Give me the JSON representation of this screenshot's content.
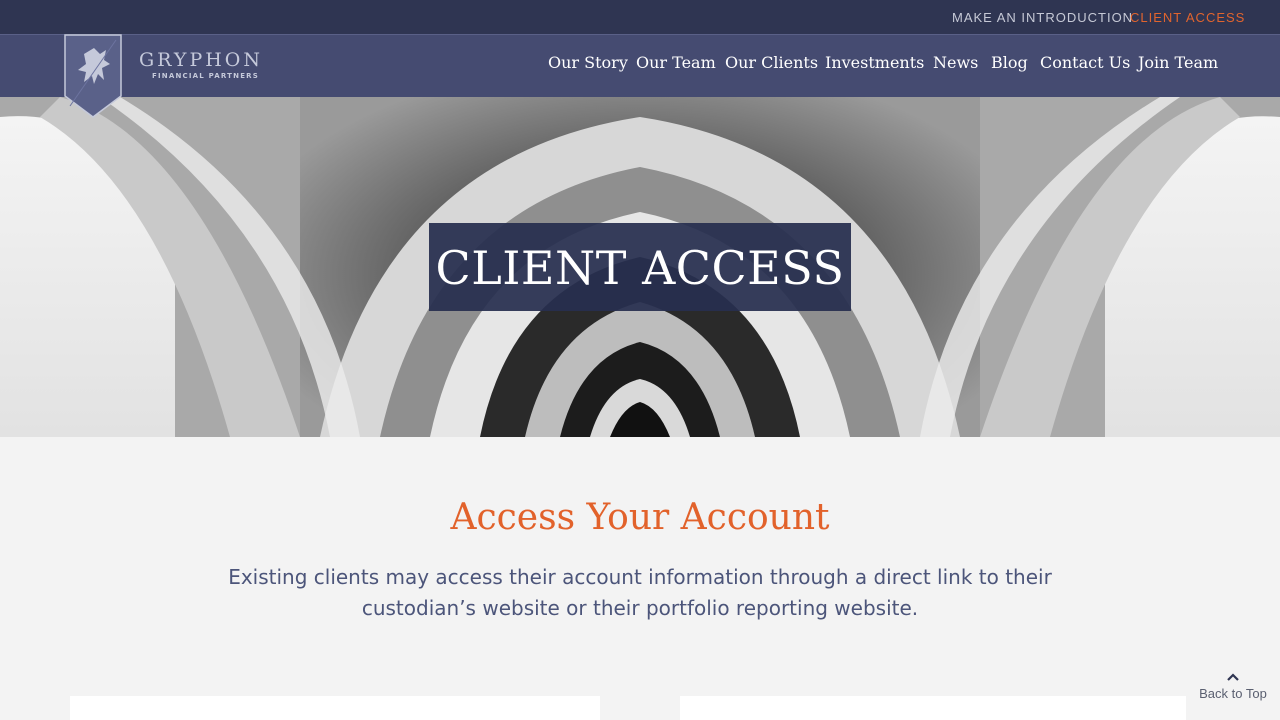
{
  "topbar": {
    "introduction": "MAKE AN INTRODUCTION",
    "client_access": "CLIENT ACCESS"
  },
  "brand": {
    "name": "GRYPHON",
    "tagline": "FINANCIAL PARTNERS"
  },
  "nav": {
    "items": [
      {
        "label": "Our Story"
      },
      {
        "label": "Our Team"
      },
      {
        "label": "Our Clients"
      },
      {
        "label": "Investments"
      },
      {
        "label": "News"
      },
      {
        "label": "Blog"
      },
      {
        "label": "Contact Us"
      },
      {
        "label": "Join Team"
      }
    ]
  },
  "hero": {
    "title": "CLIENT ACCESS"
  },
  "main": {
    "heading": "Access Your Account",
    "description": "Existing clients may access their account information through a direct link to their custodian’s website or their portfolio reporting website."
  },
  "back_to_top": {
    "label": "Back to Top",
    "icon": "chevron-up-icon"
  },
  "colors": {
    "topbar_bg": "#2f3552",
    "navbar_bg": "#454b71",
    "accent_orange": "#e2622b",
    "text_navy": "#4c557a"
  }
}
